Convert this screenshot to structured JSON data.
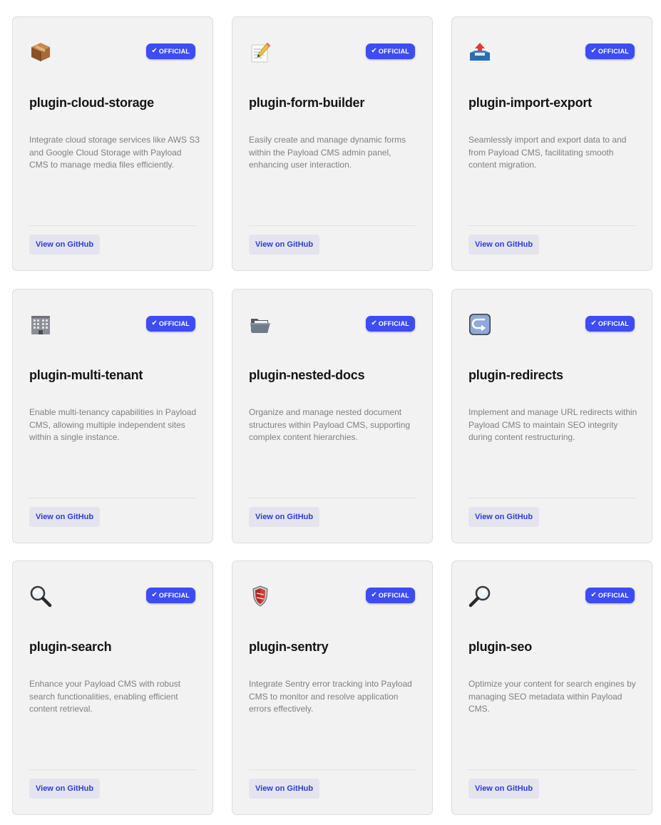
{
  "plugins": [
    {
      "name": "plugin-cloud-storage",
      "description": "Integrate cloud storage services like AWS S3 and Google Cloud Storage with Payload CMS to manage media files efficiently.",
      "icon": "package-icon",
      "badge": "OFFICIAL",
      "button": "View on GitHub"
    },
    {
      "name": "plugin-form-builder",
      "description": "Easily create and manage dynamic forms within the Payload CMS admin panel, enhancing user interaction.",
      "icon": "memo-icon",
      "badge": "OFFICIAL",
      "button": "View on GitHub"
    },
    {
      "name": "plugin-import-export",
      "description": "Seamlessly import and export data to and from Payload CMS, facilitating smooth content migration.",
      "icon": "outbox-tray-icon",
      "badge": "OFFICIAL",
      "button": "View on GitHub"
    },
    {
      "name": "plugin-multi-tenant",
      "description": "Enable multi-tenancy capabilities in Payload CMS, allowing multiple independent sites within a single instance.",
      "icon": "office-building-icon",
      "badge": "OFFICIAL",
      "button": "View on GitHub"
    },
    {
      "name": "plugin-nested-docs",
      "description": "Organize and manage nested document structures within Payload CMS, supporting complex content hierarchies.",
      "icon": "open-folder-icon",
      "badge": "OFFICIAL",
      "button": "View on GitHub"
    },
    {
      "name": "plugin-redirects",
      "description": "Implement and manage URL redirects within Payload CMS to maintain SEO integrity during content restructuring.",
      "icon": "redirect-arrow-icon",
      "badge": "OFFICIAL",
      "button": "View on GitHub"
    },
    {
      "name": "plugin-search",
      "description": "Enhance your Payload CMS with robust search functionalities, enabling efficient content retrieval.",
      "icon": "magnifier-left-icon",
      "badge": "OFFICIAL",
      "button": "View on GitHub"
    },
    {
      "name": "plugin-sentry",
      "description": "Integrate Sentry error tracking into Payload CMS to monitor and resolve application errors effectively.",
      "icon": "shield-icon",
      "badge": "OFFICIAL",
      "button": "View on GitHub"
    },
    {
      "name": "plugin-seo",
      "description": "Optimize your content for search engines by managing SEO metadata within Payload CMS.",
      "icon": "magnifier-right-icon",
      "badge": "OFFICIAL",
      "button": "View on GitHub"
    }
  ],
  "colors": {
    "badge": "#3d4cf4",
    "button_text": "#2d3bd9",
    "card_bg": "#f2f2f3"
  }
}
